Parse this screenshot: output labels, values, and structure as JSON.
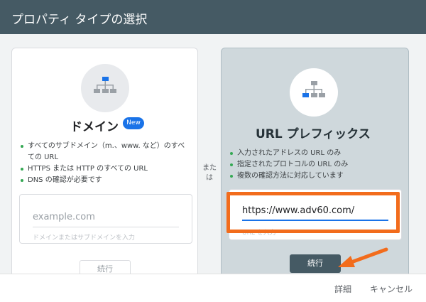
{
  "header": {
    "title": "プロパティ タイプの選択"
  },
  "domain_card": {
    "title": "ドメイン",
    "badge": "New",
    "bullets": [
      "すべてのサブドメイン（m.、www. など）のすべての URL",
      "HTTPS または HTTP のすべての URL",
      "DNS の確認が必要です"
    ],
    "input_placeholder": "example.com",
    "input_hint": "ドメインまたはサブドメインを入力",
    "continue_label": "続行"
  },
  "or_label": "または",
  "url_card": {
    "title": "URL プレフィックス",
    "bullets": [
      "入力されたアドレスの URL のみ",
      "指定されたプロトコルの URL のみ",
      "複数の確認方法に対応しています"
    ],
    "input_value": "https://www.adv60.com/",
    "input_hint": "URL を入力",
    "continue_label": "続行"
  },
  "footer": {
    "details_label": "詳細",
    "cancel_label": "キャンセル"
  },
  "colors": {
    "header": "#455a64",
    "accent": "#1a73e8",
    "highlight": "#f26c1c"
  }
}
